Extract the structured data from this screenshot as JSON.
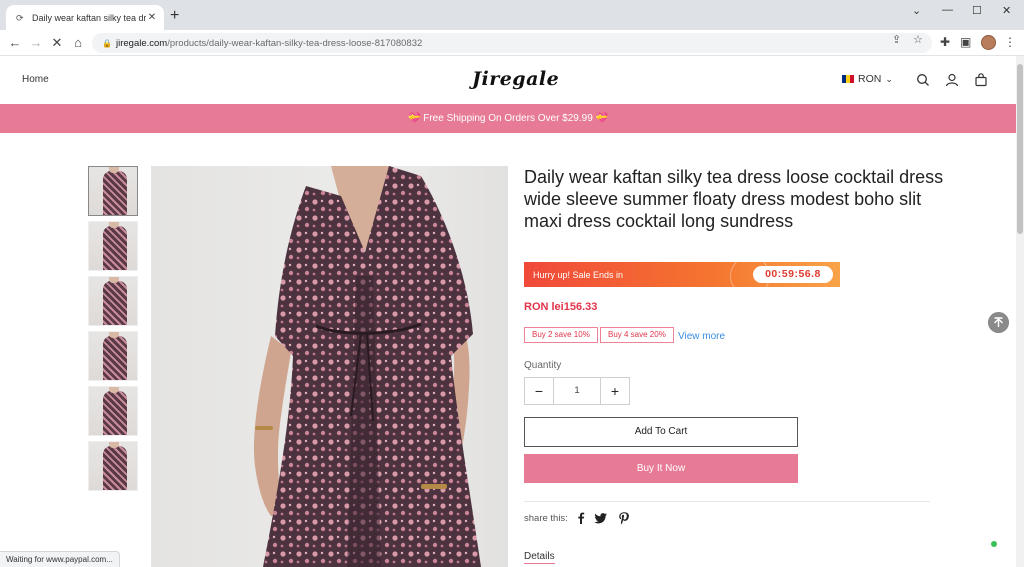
{
  "browser": {
    "tab_title": "Daily wear kaftan silky tea dress",
    "tab_close": "✕",
    "new_tab": "+",
    "url_domain": "jiregale.com",
    "url_path": "/products/daily-wear-kaftan-silky-tea-dress-loose-817080832",
    "status_text": "Waiting for www.paypal.com..."
  },
  "header": {
    "home_label": "Home",
    "logo": "Jiregale",
    "currency": "RON",
    "flag_colors": [
      "#002B7F",
      "#FCD116",
      "#CE1126"
    ]
  },
  "banner": {
    "text": "💝 Free Shipping On Orders Over $29.99 💝"
  },
  "product": {
    "title": "Daily wear kaftan silky tea dress loose cocktail dress wide sleeve summer floaty dress modest boho slit maxi dress cocktail long sundress",
    "sale_label": "Hurry up! Sale Ends in",
    "countdown": "00:59:56.8",
    "price": "RON lei156.33",
    "promos": [
      "Buy 2 save 10%",
      "Buy 4 save 20%"
    ],
    "view_more": "View more",
    "quantity_label": "Quantity",
    "quantity_value": "1",
    "minus": "−",
    "plus": "+",
    "add_to_cart": "Add To Cart",
    "buy_now": "Buy It Now",
    "share_label": "share this:",
    "details_label": "Details"
  },
  "colors": {
    "accent_pink": "#e77b95",
    "price_red": "#e1354a",
    "link_blue": "#3b8de0"
  }
}
